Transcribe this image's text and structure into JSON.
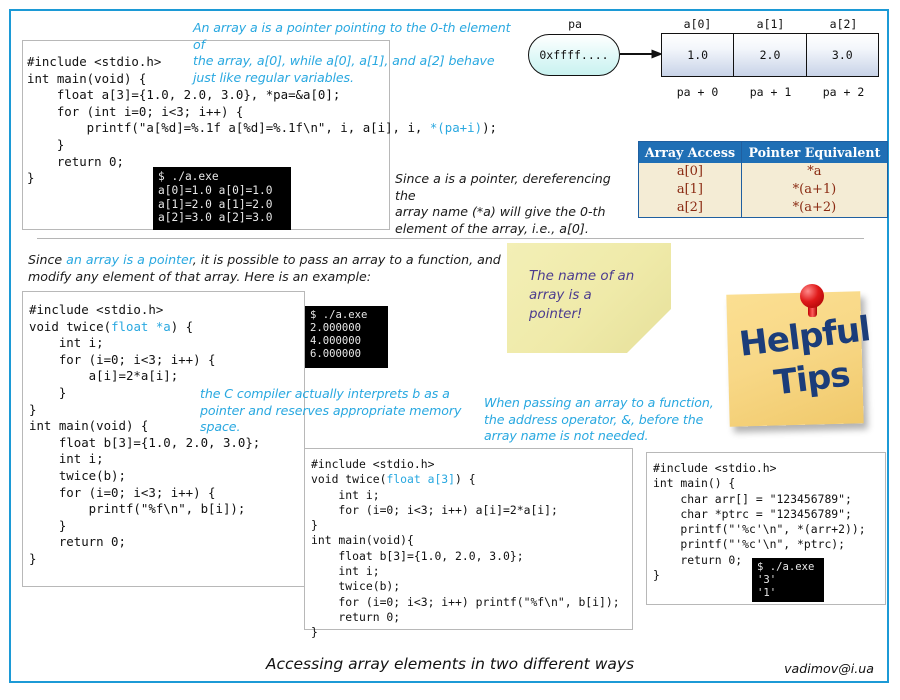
{
  "slide": {
    "caption": "Accessing array elements in two different ways",
    "credit": "vadimov@i.ua",
    "frame_color": "#1c9ad6",
    "annotation_color": "#29a8e0"
  },
  "section1": {
    "code1": "#include <stdio.h>\nint main(void) {\n    float a[3]={1.0, 2.0, 3.0}, *pa=&a[0];\n    for (int i=0; i<3; i++) {\n        printf(\"a[%d]=%.1f a[%d]=%.1f\\n\", i, a[i], i, ",
    "code1_kw": "*(pa+i)",
    "code1_tail": ");\n    }\n    return 0;\n}",
    "terminal1": "$ ./a.exe\na[0]=1.0 a[0]=1.0\na[1]=2.0 a[1]=2.0\na[2]=3.0 a[2]=3.0",
    "annotation_top": "An array a is a pointer pointing to the 0-th element of the array, a[0], while a[0], a[1], and a[2] behave just like regular variables.",
    "annotation_top_lines": [
      "An array a is a pointer pointing to the 0-th element of",
      "the array, a[0], while a[0], a[1], and a[2] behave",
      "just like regular variables."
    ],
    "note_deref_lines": [
      "Since a is a pointer, dereferencing the",
      "array name (*a)  will give the 0-th",
      "element of the array, i.e., a[0]."
    ]
  },
  "diagram": {
    "pa_label": "pa",
    "pa_value": "0xffff....",
    "cell_labels": [
      "a[0]",
      "a[1]",
      "a[2]"
    ],
    "cell_values": [
      "1.0",
      "2.0",
      "3.0"
    ],
    "offset_labels": [
      "pa + 0",
      "pa + 1",
      "pa + 2"
    ]
  },
  "table": {
    "headers": [
      "Array Access",
      "Pointer Equivalent"
    ],
    "rows": [
      [
        "a[0]",
        "*a"
      ],
      [
        "a[1]",
        "*(a+1)"
      ],
      [
        "a[2]",
        "*(a+2)"
      ]
    ],
    "header_bg": "#1f6fb5",
    "body_bg": "#f4ecd5",
    "body_fg": "#8a2a12"
  },
  "section2": {
    "intro_pre": "Since ",
    "intro_link": "an array is a pointer",
    "intro_post_lines": [
      ", it is possible to pass an array to a function, and",
      "modify any element of that array. Here is an example:"
    ],
    "code2_head": "#include <stdio.h>\nvoid twice(",
    "code2_kw": "float *a",
    "code2_body": ") {\n    int i;\n    for (i=0; i<3; i++) {\n        a[i]=2*a[i];\n    }\n}\nint main(void) {\n    float b[3]={1.0, 2.0, 3.0};\n    int i;\n    twice(b);\n    for (i=0; i<3; i++) {\n        printf(\"%f\\n\", b[i]);\n    }\n    return 0;\n}",
    "terminal2": "$ ./a.exe\n2.000000\n4.000000\n6.000000",
    "annotation_compiler_lines": [
      "the C compiler actually interprets b as a",
      "pointer and reserves appropriate memory",
      "space."
    ],
    "annotation_passing_lines": [
      "When passing an array to a function,",
      "the address operator, &, before the",
      "array name is not needed."
    ],
    "code3_head": "#include <stdio.h>\nvoid twice(",
    "code3_kw": "float a[3]",
    "code3_body": ") {\n    int i;\n    for (i=0; i<3; i++) a[i]=2*a[i];\n}\nint main(void){\n    float b[3]={1.0, 2.0, 3.0};\n    int i;\n    twice(b);\n    for (i=0; i<3; i++) printf(\"%f\\n\", b[i]);\n    return 0;\n}",
    "code4": "#include <stdio.h>\nint main() {\n    char arr[] = \"123456789\";\n    char *ptrc = \"123456789\";\n    printf(\"'%c'\\n\", *(arr+2));\n    printf(\"'%c'\\n\", *ptrc);\n    return 0;\n}",
    "terminal3": "$ ./a.exe\n'3'\n'1'"
  },
  "sticky_note": {
    "line1": "The name of an",
    "line2": "array is a pointer!",
    "text_color": "#4b3b8f"
  },
  "tips_note": {
    "word1": "Helpful",
    "word2": "Tips",
    "text_color": "#1b3d7a"
  }
}
